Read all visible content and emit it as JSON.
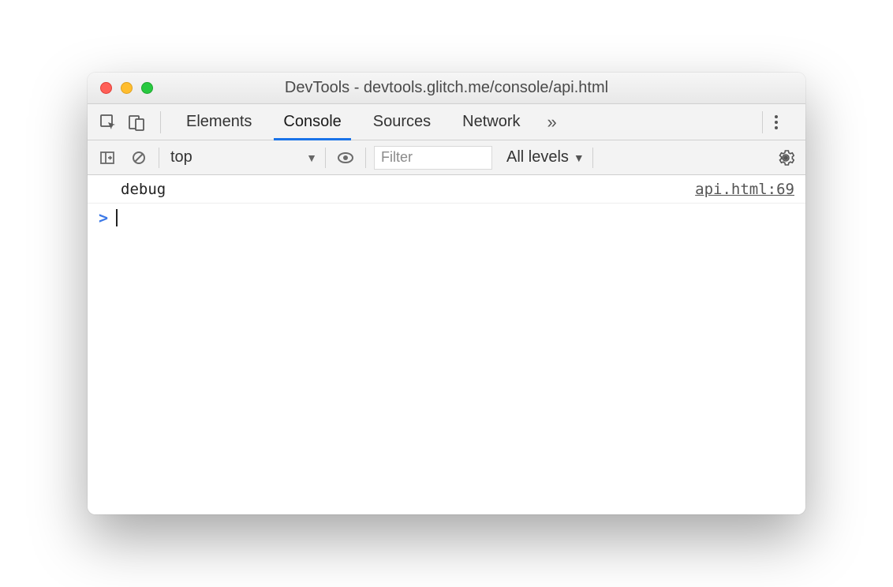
{
  "window": {
    "title": "DevTools - devtools.glitch.me/console/api.html"
  },
  "tabs": {
    "items": [
      "Elements",
      "Console",
      "Sources",
      "Network"
    ],
    "active_index": 1,
    "overflow_glyph": "»"
  },
  "toolbar": {
    "context": "top",
    "filter_placeholder": "Filter",
    "levels_label": "All levels"
  },
  "console": {
    "rows": [
      {
        "text": "debug",
        "source": "api.html:69"
      }
    ],
    "prompt_glyph": ">"
  }
}
